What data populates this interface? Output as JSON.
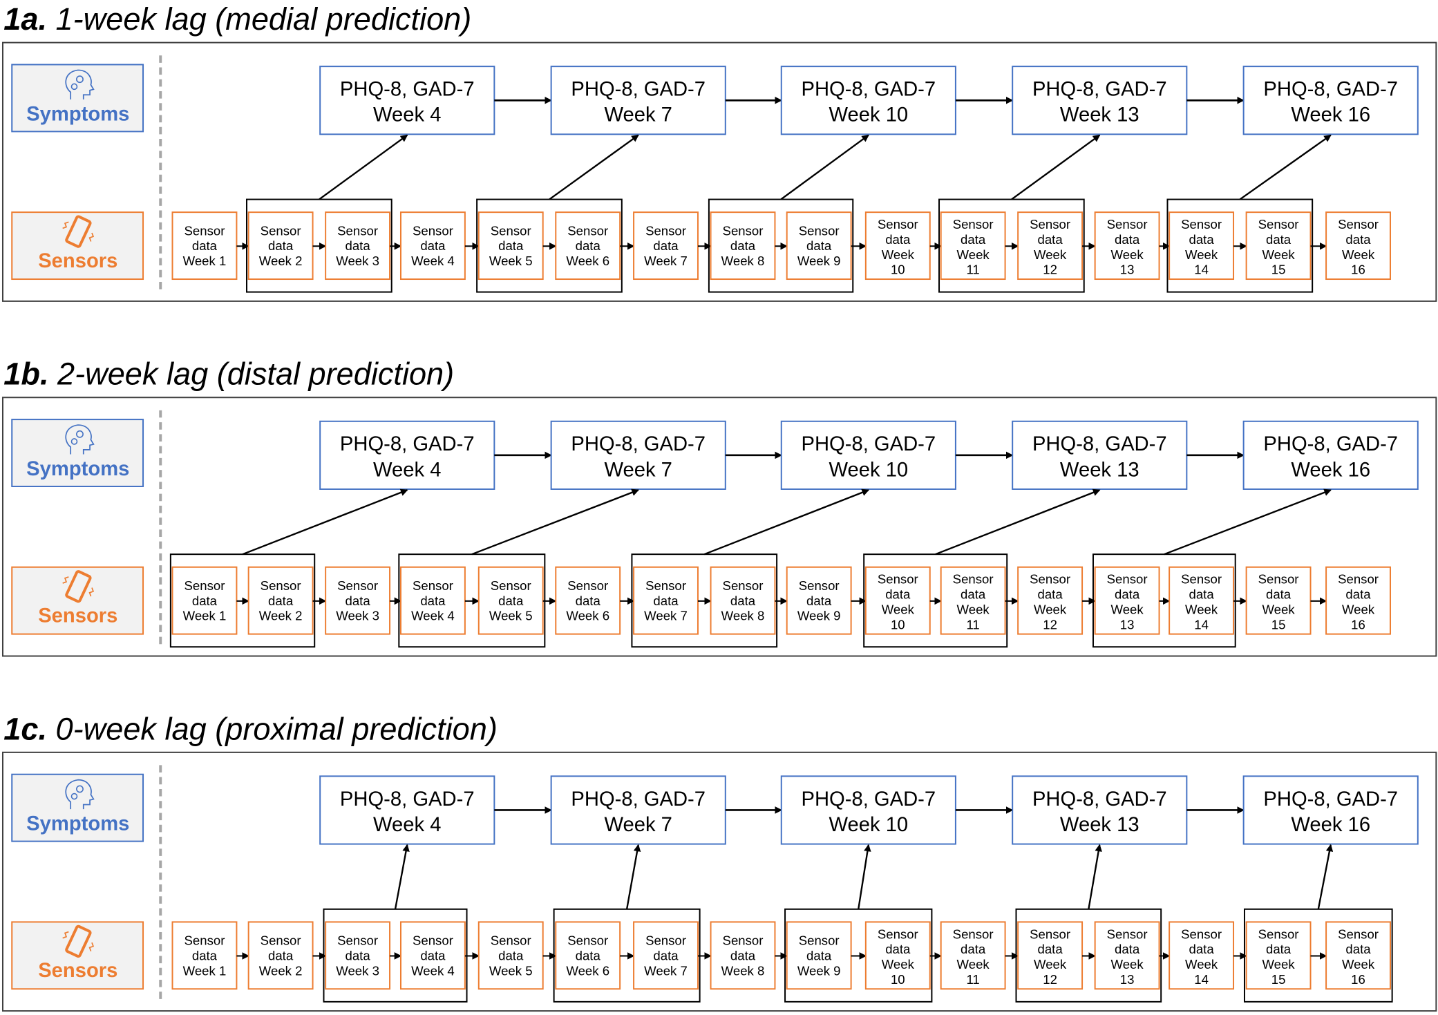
{
  "colors": {
    "symptoms": "#4472c4",
    "sensors": "#ed7d31",
    "label_bg": "#f2f2f2",
    "arrow": "#000000",
    "divider": "#a6a6a6"
  },
  "labels": {
    "symptoms": "Symptoms",
    "sensors": "Sensors",
    "symptoms_icon": "head-gears-icon",
    "sensors_icon": "vibrating-phone-icon"
  },
  "symptom_boxes": [
    {
      "line1": "PHQ-8, GAD-7",
      "line2": "Week 4"
    },
    {
      "line1": "PHQ-8, GAD-7",
      "line2": "Week 7"
    },
    {
      "line1": "PHQ-8, GAD-7",
      "line2": "Week 10"
    },
    {
      "line1": "PHQ-8, GAD-7",
      "line2": "Week 13"
    },
    {
      "line1": "PHQ-8, GAD-7",
      "line2": "Week 16"
    }
  ],
  "sensor_box": {
    "line1": "Sensor",
    "line2": "data",
    "week_prefix": "Week"
  },
  "sensor_weeks": [
    1,
    2,
    3,
    4,
    5,
    6,
    7,
    8,
    9,
    10,
    11,
    12,
    13,
    14,
    15,
    16
  ],
  "panels": [
    {
      "id": "1a",
      "label": "1a.",
      "title": "1-week lag (medial prediction)",
      "groups": [
        [
          2,
          3
        ],
        [
          5,
          6
        ],
        [
          8,
          9
        ],
        [
          11,
          12
        ],
        [
          14,
          15
        ]
      ]
    },
    {
      "id": "1b",
      "label": "1b.",
      "title": "2-week lag (distal prediction)",
      "groups": [
        [
          1,
          2
        ],
        [
          4,
          5
        ],
        [
          7,
          8
        ],
        [
          10,
          11
        ],
        [
          13,
          14
        ]
      ]
    },
    {
      "id": "1c",
      "label": "1c.",
      "title": "0-week lag (proximal prediction)",
      "groups": [
        [
          3,
          4
        ],
        [
          6,
          7
        ],
        [
          9,
          10
        ],
        [
          12,
          13
        ],
        [
          15,
          16
        ]
      ]
    }
  ]
}
